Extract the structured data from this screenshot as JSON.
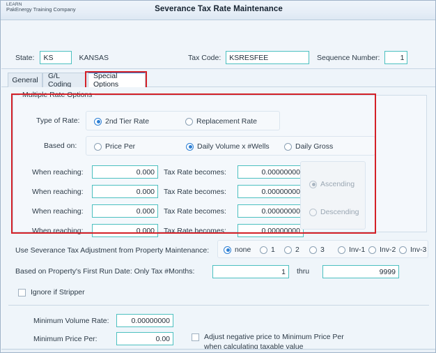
{
  "window": {
    "brand_top": "LEARN",
    "brand_sub": "PakEnergy Training Company",
    "title": "Severance Tax Rate Maintenance"
  },
  "header": {
    "state_label": "State:",
    "state_value": "KS",
    "state_name": "KANSAS",
    "tax_code_label": "Tax Code:",
    "tax_code_value": "KSRESFEE",
    "sequence_label": "Sequence Number:",
    "sequence_value": "1"
  },
  "tabs": [
    {
      "label": "General",
      "active": false
    },
    {
      "label": "G/L Coding",
      "active": false
    },
    {
      "label": "Special Options",
      "active": true
    }
  ],
  "multiple_rate_options": {
    "group_title": "Multiple Rate Options",
    "type_of_rate_label": "Type of Rate:",
    "type_of_rate_options": [
      {
        "label": "2nd Tier Rate",
        "selected": true
      },
      {
        "label": "Replacement Rate",
        "selected": false
      }
    ],
    "based_on_label": "Based on:",
    "based_on_options": [
      {
        "label": "Price Per",
        "selected": false
      },
      {
        "label": "Daily Volume x #Wells",
        "selected": true
      },
      {
        "label": "Daily Gross",
        "selected": false
      }
    ],
    "rate_rows": [
      {
        "when_label": "When reaching:",
        "when_value": "0.000",
        "becomes_label": "Tax Rate becomes:",
        "becomes_value": "0.00000000"
      },
      {
        "when_label": "When reaching:",
        "when_value": "0.000",
        "becomes_label": "Tax Rate becomes:",
        "becomes_value": "0.00000000"
      },
      {
        "when_label": "When reaching:",
        "when_value": "0.000",
        "becomes_label": "Tax Rate becomes:",
        "becomes_value": "0.00000000"
      },
      {
        "when_label": "When reaching:",
        "when_value": "0.000",
        "becomes_label": "Tax Rate becomes:",
        "becomes_value": "0.00000000"
      }
    ],
    "sort_options": [
      {
        "label": "Ascending",
        "selected": true,
        "disabled": true
      },
      {
        "label": "Descending",
        "selected": false,
        "disabled": true
      }
    ]
  },
  "adjustment": {
    "label": "Use Severance Tax Adjustment from Property Maintenance:",
    "options": [
      {
        "label": "none",
        "selected": true
      },
      {
        "label": "1",
        "selected": false
      },
      {
        "label": "2",
        "selected": false
      },
      {
        "label": "3",
        "selected": false
      },
      {
        "label": "Inv-1",
        "selected": false
      },
      {
        "label": "Inv-2",
        "selected": false
      },
      {
        "label": "Inv-3",
        "selected": false
      }
    ]
  },
  "first_run": {
    "label": "Based on Property's First Run  Date: Only Tax #Months:",
    "from_value": "1",
    "thru_label": "thru",
    "to_value": "9999"
  },
  "stripper": {
    "label": "Ignore if Stripper",
    "checked": false
  },
  "minimums": {
    "volume_rate_label": "Minimum Volume Rate:",
    "volume_rate_value": "0.00000000",
    "price_per_label": "Minimum Price Per:",
    "price_per_value": "0.00",
    "adjust_line1": "Adjust negative price to Minimum Price Per",
    "adjust_line2": "when calculating taxable value",
    "adjust_checked": false
  },
  "colors": {
    "field_border": "#4cc0c0",
    "annotation": "#d42027",
    "accent": "#2c7fd4",
    "panel_bg": "#f6f9fc"
  }
}
